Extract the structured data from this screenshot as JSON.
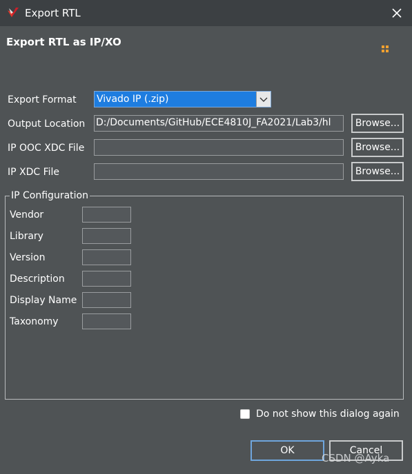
{
  "window": {
    "title": "Export RTL"
  },
  "header": {
    "title": "Export RTL as IP/XO"
  },
  "form": {
    "export_format_label": "Export Format",
    "export_format_value": "Vivado IP (.zip)",
    "output_location_label": "Output Location",
    "output_location_value": "D:/Documents/GitHub/ECE4810J_FA2021/Lab3/hl",
    "ip_ooc_xdc_label": "IP OOC XDC File",
    "ip_ooc_xdc_value": "",
    "ip_xdc_label": "IP XDC File",
    "ip_xdc_value": "",
    "browse_label": "Browse..."
  },
  "ip_config": {
    "title": "IP Configuration",
    "fields": [
      {
        "label": "Vendor",
        "value": ""
      },
      {
        "label": "Library",
        "value": ""
      },
      {
        "label": "Version",
        "value": ""
      },
      {
        "label": "Description",
        "value": ""
      },
      {
        "label": "Display Name",
        "value": ""
      },
      {
        "label": "Taxonomy",
        "value": ""
      }
    ]
  },
  "footer": {
    "dont_show_label": "Do not show this dialog again",
    "ok_label": "OK",
    "cancel_label": "Cancel"
  },
  "watermark": "CSDN @Ayka",
  "colors": {
    "background": "#4f5355",
    "titlebar": "#3c4043",
    "selection": "#1e7de0"
  },
  "icons": {
    "app": "vivado-logo-icon",
    "close": "close-icon",
    "help": "grid-help-icon",
    "dropdown": "chevron-down-icon"
  }
}
